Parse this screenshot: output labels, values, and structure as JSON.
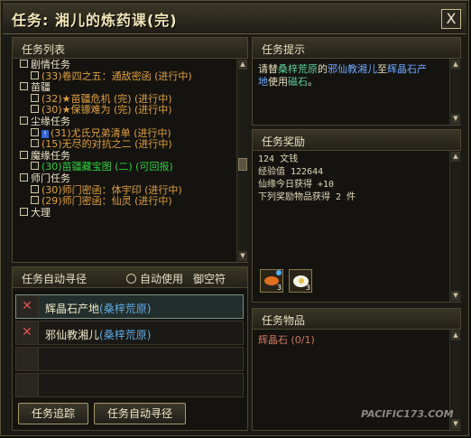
{
  "window": {
    "title": "任务: 湘儿的炼药课(完)",
    "close_label": "X"
  },
  "task_list": {
    "header": "任务列表",
    "rows": [
      {
        "text": "剧情任务",
        "level": 1,
        "color": "white"
      },
      {
        "text": "(33)卷四之五：通敌密函 (进行中)",
        "level": 2,
        "color": "orange"
      },
      {
        "text": "苗疆",
        "level": 1,
        "color": "white"
      },
      {
        "text": "(32)★苗疆危机 (完) (进行中)",
        "level": 2,
        "color": "orange"
      },
      {
        "text": "(30)★保镖难为 (完) (进行中)",
        "level": 2,
        "color": "orange"
      },
      {
        "text": "尘缘任务",
        "level": 1,
        "color": "white"
      },
      {
        "text": "(31)尤氏兄弟清单 (进行中)",
        "level": 2,
        "color": "orange",
        "excl": "!"
      },
      {
        "text": "(15)无尽的对抗之二 (进行中)",
        "level": 2,
        "color": "orange"
      },
      {
        "text": "魔缘任务",
        "level": 1,
        "color": "white"
      },
      {
        "text": "(30)苗疆藏宝图 (二) (可回报)",
        "level": 2,
        "color": "green"
      },
      {
        "text": "师门任务",
        "level": 1,
        "color": "white"
      },
      {
        "text": "(30)师门密函：体宇印 (进行中)",
        "level": 2,
        "color": "orange"
      },
      {
        "text": "(29)师门密函：仙灵 (进行中)",
        "level": 2,
        "color": "orange"
      },
      {
        "text": "大理",
        "level": 1,
        "color": "white"
      }
    ]
  },
  "auto_nav": {
    "header": "任务自动寻径",
    "auto_use_label": "自动使用",
    "fly_label": "御空符",
    "rows": [
      {
        "place": "辉晶石产地",
        "area": "(桑梓荒原)"
      },
      {
        "place": "邪仙教湘儿",
        "area": "(桑梓荒原)"
      }
    ],
    "track_button": "任务追踪",
    "nav_button": "任务自动寻径"
  },
  "hint": {
    "header": "任务提示",
    "p1": "请替",
    "l1": "桑梓荒原",
    "p2": "的",
    "l2": "邪仙教湘儿",
    "p3": "至",
    "l3": "辉晶石产地",
    "p4": "使用",
    "l4": "磁石",
    "p5": "。"
  },
  "reward": {
    "header": "任务奖励",
    "lines": [
      "124 文钱",
      "经验值 122644",
      "仙缘今日获得 +10",
      "下列奖励物品获得 2 件"
    ],
    "items": [
      {
        "icon": "orange-medicine-icon",
        "qty": "3"
      },
      {
        "icon": "white-egg-icon",
        "qty": "3"
      }
    ]
  },
  "goods": {
    "header": "任务物品",
    "item": "辉晶石 (0/1)"
  },
  "watermark": {
    "site": "PACIFIC173.COM"
  },
  "colors": {
    "orange": "#e0a040",
    "green": "#30d040",
    "loc_blue": "#5fa8e0"
  }
}
